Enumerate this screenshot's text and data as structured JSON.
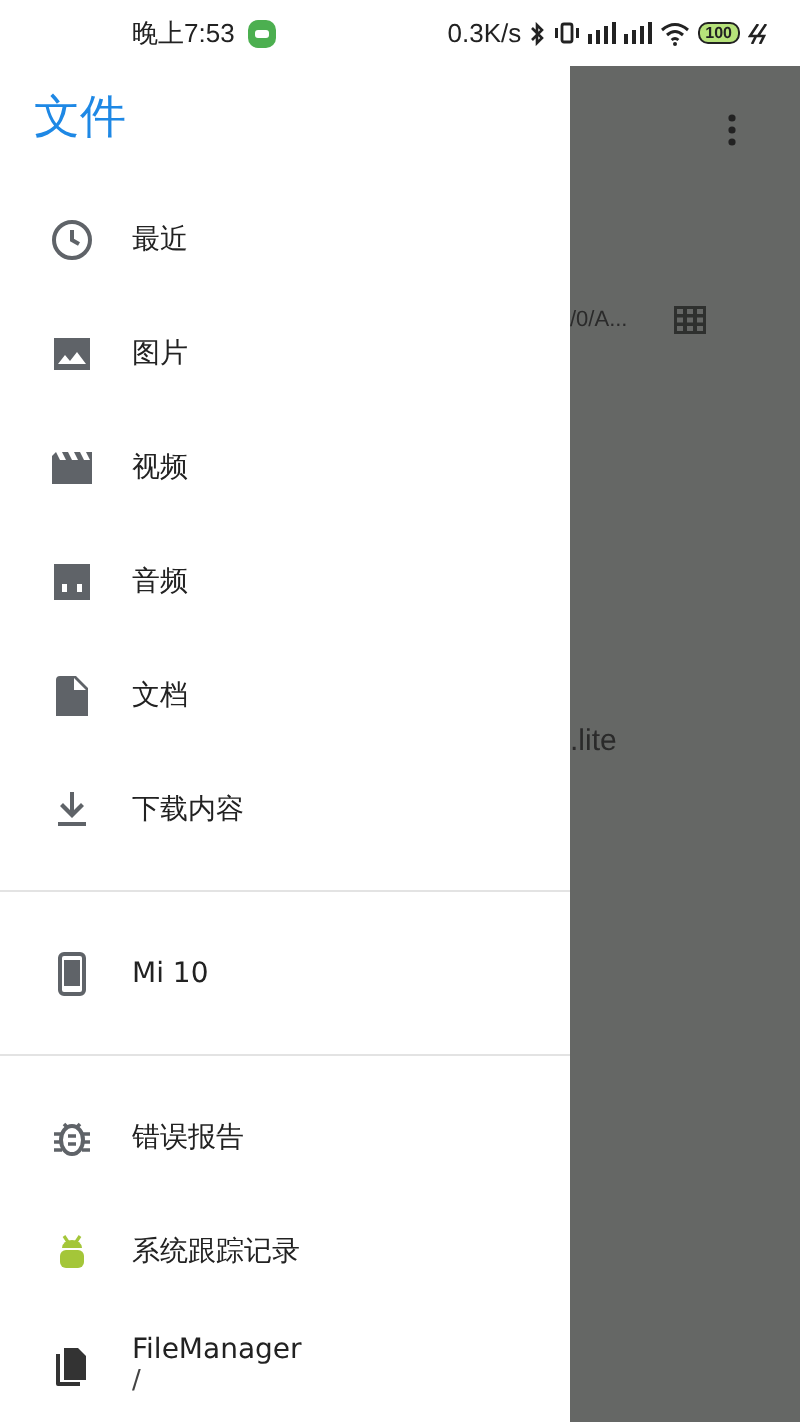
{
  "status_bar": {
    "time": "晚上7:53",
    "speed": "0.3K/s",
    "battery": "100"
  },
  "drawer": {
    "title": "文件",
    "sections": [
      {
        "items": [
          {
            "kind": "recent",
            "label": "最近"
          },
          {
            "kind": "images",
            "label": "图片"
          },
          {
            "kind": "videos",
            "label": "视频"
          },
          {
            "kind": "audio",
            "label": "音频"
          },
          {
            "kind": "documents",
            "label": "文档"
          },
          {
            "kind": "downloads",
            "label": "下载内容"
          }
        ]
      },
      {
        "items": [
          {
            "kind": "device",
            "label": "Mi 10"
          }
        ]
      },
      {
        "items": [
          {
            "kind": "bug",
            "label": "错误报告"
          },
          {
            "kind": "trace",
            "label": "系统跟踪记录"
          },
          {
            "kind": "app",
            "label": "FileManager",
            "subtitle": "/"
          }
        ]
      }
    ]
  },
  "background": {
    "path": "/0/A...",
    "file": ".lite"
  }
}
